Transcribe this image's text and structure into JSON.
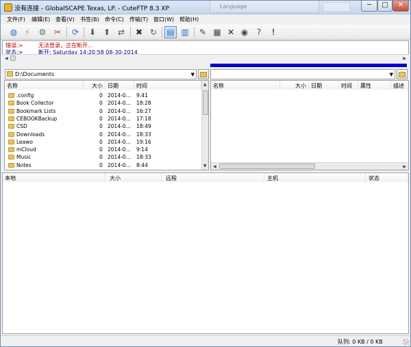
{
  "window": {
    "title": "没有连接 - GlobalSCAPE Texas, LP. - CuteFTP 8.3 XP",
    "background_tab": "Language",
    "controls": {
      "minimize": "─",
      "maximize": "□",
      "close": "✕"
    }
  },
  "menu": [
    "文件(F)",
    "编辑(E)",
    "查看(V)",
    "书签(B)",
    "命令(C)",
    "传输(T)",
    "窗口(W)",
    "帮助(H)"
  ],
  "toolbar_icons": [
    {
      "name": "site-manager-icon",
      "glyph": "◍",
      "color": "#2a6cc2"
    },
    {
      "name": "quick-connect-icon",
      "glyph": "⚡",
      "color": "#d89b1a"
    },
    {
      "name": "connect-icon",
      "glyph": "⚙",
      "color": "#3b8a3b"
    },
    {
      "name": "disconnect-icon",
      "glyph": "✂",
      "color": "#c03a2b"
    },
    {
      "name": "reconnect-icon",
      "glyph": "⟳",
      "color": "#2a6cc2"
    },
    {
      "name": "download-icon",
      "glyph": "⬇",
      "color": "#555555"
    },
    {
      "name": "upload-icon",
      "glyph": "⬆",
      "color": "#555555"
    },
    {
      "name": "transfer-icon",
      "glyph": "⇄",
      "color": "#555555"
    },
    {
      "name": "stop-icon",
      "glyph": "✖",
      "color": "#333333"
    },
    {
      "name": "refresh-icon",
      "glyph": "↻",
      "color": "#555555"
    },
    {
      "name": "local-view-icon",
      "glyph": "▤",
      "color": "#2a6cc2"
    },
    {
      "name": "remote-view-icon",
      "glyph": "▥",
      "color": "#2a6cc2"
    },
    {
      "name": "edit-icon",
      "glyph": "✎",
      "color": "#444444"
    },
    {
      "name": "properties-icon",
      "glyph": "▦",
      "color": "#444444"
    },
    {
      "name": "delete-icon",
      "glyph": "✕",
      "color": "#222222"
    },
    {
      "name": "view-file-icon",
      "glyph": "◉",
      "color": "#444444"
    },
    {
      "name": "help-icon",
      "glyph": "?",
      "color": "#444444"
    },
    {
      "name": "alert-icon",
      "glyph": "!",
      "color": "#111111"
    }
  ],
  "log": [
    {
      "key": "错误:>",
      "value": "无法登录，正在断开..."
    },
    {
      "key": "状态:>",
      "value": "断开: Saturday 14:20:58 08-30-2014"
    }
  ],
  "local": {
    "path": "D:\\Documents",
    "headers": {
      "name": "名称",
      "size": "大小",
      "date": "日期",
      "time": "时间"
    },
    "rows": [
      {
        "name": ".config",
        "size": "0",
        "date": "2014-0...",
        "time": "9:41"
      },
      {
        "name": "Book Collector",
        "size": "0",
        "date": "2014-0...",
        "time": "18:28"
      },
      {
        "name": "Bookmark Lists",
        "size": "0",
        "date": "2014-0...",
        "time": "16:27"
      },
      {
        "name": "CEBOOKBackup",
        "size": "0",
        "date": "2014-0...",
        "time": "17:18"
      },
      {
        "name": "CSD",
        "size": "0",
        "date": "2014-0...",
        "time": "18:49"
      },
      {
        "name": "Downloads",
        "size": "0",
        "date": "2014-0...",
        "time": "18:33"
      },
      {
        "name": "Leawo",
        "size": "0",
        "date": "2014-0...",
        "time": "19:16"
      },
      {
        "name": "mCloud",
        "size": "0",
        "date": "2014-0...",
        "time": "9:14"
      },
      {
        "name": "Music",
        "size": "0",
        "date": "2014-0...",
        "time": "18:33"
      },
      {
        "name": "Notes",
        "size": "0",
        "date": "2014-0...",
        "time": "8:44"
      }
    ]
  },
  "remote": {
    "headers": {
      "name": "名称",
      "size": "大小",
      "date": "日期",
      "time": "时间",
      "attr": "属性",
      "desc": "描述"
    }
  },
  "queue": {
    "headers": {
      "local": "本地",
      "size": "大小",
      "remote": "远程",
      "host": "主机",
      "status": "状态"
    }
  },
  "statusbar": {
    "text": "队列: 0 KB / 0 KB"
  }
}
